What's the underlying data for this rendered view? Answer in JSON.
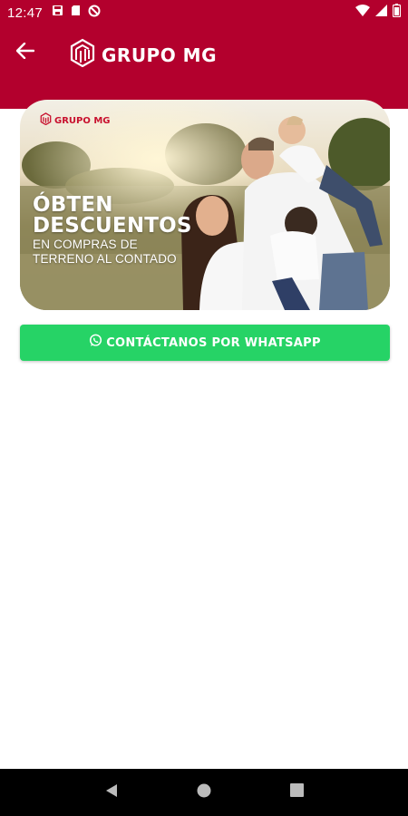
{
  "status_bar": {
    "time": "12:47",
    "left_icons": [
      "save-icon",
      "sd-card-icon",
      "do-not-disturb-icon"
    ],
    "right_icons": [
      "wifi-icon",
      "signal-icon",
      "battery-icon"
    ]
  },
  "app_bar": {
    "back_icon": "arrow-back-icon",
    "brand_name": "GRUPO MG",
    "background_color": "#b3002d"
  },
  "banner": {
    "logo_text": "GRUPO MG",
    "title_line1": "ÓBTEN",
    "title_line2": "DESCUENTOS",
    "subtitle_line1": "EN COMPRAS DE",
    "subtitle_line2": "TERRENO AL CONTADO"
  },
  "whatsapp_button": {
    "label": "CONTÁCTANOS POR WHATSAPP",
    "icon": "whatsapp-icon",
    "color": "#26d366"
  },
  "nav_bar": {
    "buttons": [
      "back-triangle-icon",
      "home-circle-icon",
      "recents-square-icon"
    ]
  }
}
